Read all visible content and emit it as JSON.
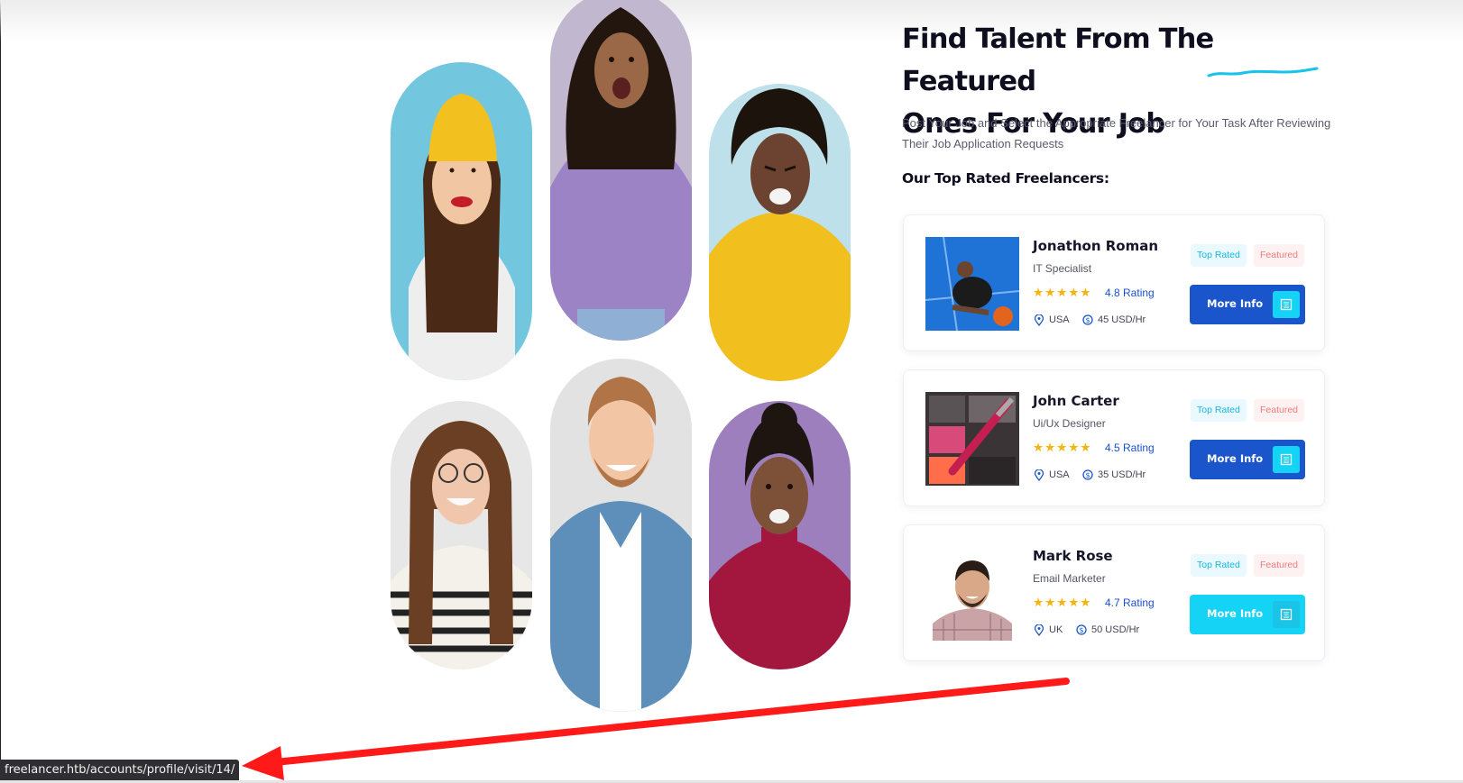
{
  "hero": {
    "headline_line1": "Find Talent From The Featured",
    "headline_line2": "Ones For Your Job",
    "lead": "Post Your Job and Select the Appropriate Freelancer for Your Task After Reviewing Their Job Application Requests",
    "subhead": "Our Top Rated Freelancers:"
  },
  "gallery": [
    {
      "name": "photo-woman-yellow-beanie",
      "bg": "#72c7de",
      "skin": "#f1c7a3",
      "hair": "#4a2a17",
      "top": "#eeeeee",
      "accent": "#f2c01f"
    },
    {
      "name": "photo-woman-purple-tshirt",
      "bg": "#c1b7cf",
      "skin": "#9a6847",
      "hair": "#23160f",
      "top": "#9c83c6",
      "accent": "#8fb0d4"
    },
    {
      "name": "photo-woman-yellow-sweater",
      "bg": "#bde0ea",
      "skin": "#6b4330",
      "hair": "#1d130d",
      "top": "#f1bf1e",
      "accent": "#f1bf1e"
    },
    {
      "name": "photo-woman-striped-top",
      "bg": "#e7e7e7",
      "skin": "#f0c7ad",
      "hair": "#6b3f24",
      "top": "#f4f1ea",
      "accent": "#222222"
    },
    {
      "name": "photo-man-denim-shirt",
      "bg": "#e2e2e2",
      "skin": "#f2c6a4",
      "hair": "#b17447",
      "top": "#5d8fba",
      "accent": "#ffffff"
    },
    {
      "name": "photo-woman-red-turtleneck",
      "bg": "#9c7fbc",
      "skin": "#7d5038",
      "hair": "#1f1510",
      "top": "#a3173e",
      "accent": "#a3173e"
    }
  ],
  "freelancers": [
    {
      "name": "Jonathon Roman",
      "role": "IT Specialist",
      "stars": "★★★★★",
      "rating": "4.8 Rating",
      "location": "USA",
      "rate": "45 USD/Hr",
      "badge_top": "Top Rated",
      "badge_featured": "Featured",
      "button": "More Info",
      "button_style": "dark",
      "photo": "basketball-player-photo"
    },
    {
      "name": "John Carter",
      "role": "Ui/Ux Designer",
      "stars": "★★★★★",
      "rating": "4.5 Rating",
      "location": "USA",
      "rate": "35 USD/Hr",
      "badge_top": "Top Rated",
      "badge_featured": "Featured",
      "button": "More Info",
      "button_style": "dark",
      "photo": "makeup-palette-photo"
    },
    {
      "name": "Mark Rose",
      "role": "Email Marketer",
      "stars": "★★★★★",
      "rating": "4.7 Rating",
      "location": "UK",
      "rate": "50 USD/Hr",
      "badge_top": "Top Rated",
      "badge_featured": "Featured",
      "button": "More Info",
      "button_style": "light",
      "photo": "man-checkered-shirt-photo"
    }
  ],
  "status_bar": {
    "url": "freelancer.htb/accounts/profile/visit/14/"
  },
  "colors": {
    "primary": "#1b55cc",
    "accent": "#14d3f5",
    "star": "#f6b40e",
    "badge_top": "#18b7e0",
    "badge_featured": "#f07c7c",
    "annotation": "#ff1a1a"
  }
}
